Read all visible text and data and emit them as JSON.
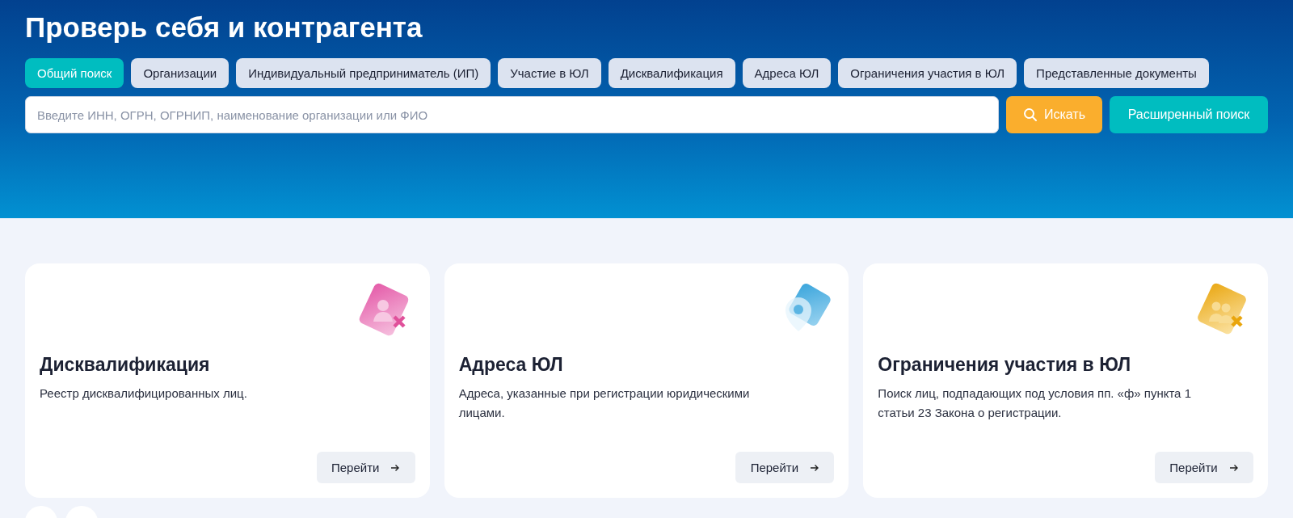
{
  "title": "Проверь себя и контрагента",
  "tabs": [
    {
      "label": "Общий поиск",
      "selected": true
    },
    {
      "label": "Организации",
      "selected": false
    },
    {
      "label": "Индивидуальный предприниматель (ИП)",
      "selected": false
    },
    {
      "label": "Участие в ЮЛ",
      "selected": false
    },
    {
      "label": "Дисквалификация",
      "selected": false
    },
    {
      "label": "Адреса ЮЛ",
      "selected": false
    },
    {
      "label": "Ограничения участия в ЮЛ",
      "selected": false
    },
    {
      "label": "Представленные документы",
      "selected": false
    }
  ],
  "search": {
    "placeholder": "Введите ИНН, ОГРН, ОГРНИП, наименование организации или ФИО",
    "search_button": "Искать",
    "advanced_button": "Расширенный поиск"
  },
  "cards": [
    {
      "kind": "disqualification",
      "title": "Дисквалификация",
      "description": "Реестр дисквалифицированных лиц.",
      "button": "Перейти"
    },
    {
      "kind": "address",
      "title": "Адреса ЮЛ",
      "description": "Адреса, указанные при регистрации юридическими лицами.",
      "button": "Перейти"
    },
    {
      "kind": "restriction",
      "title": "Ограничения участия в ЮЛ",
      "description": "Поиск лиц, подпадающих под условия пп. «ф» пункта 1 статьи 23 Закона о регистрации.",
      "button": "Перейти"
    }
  ]
}
